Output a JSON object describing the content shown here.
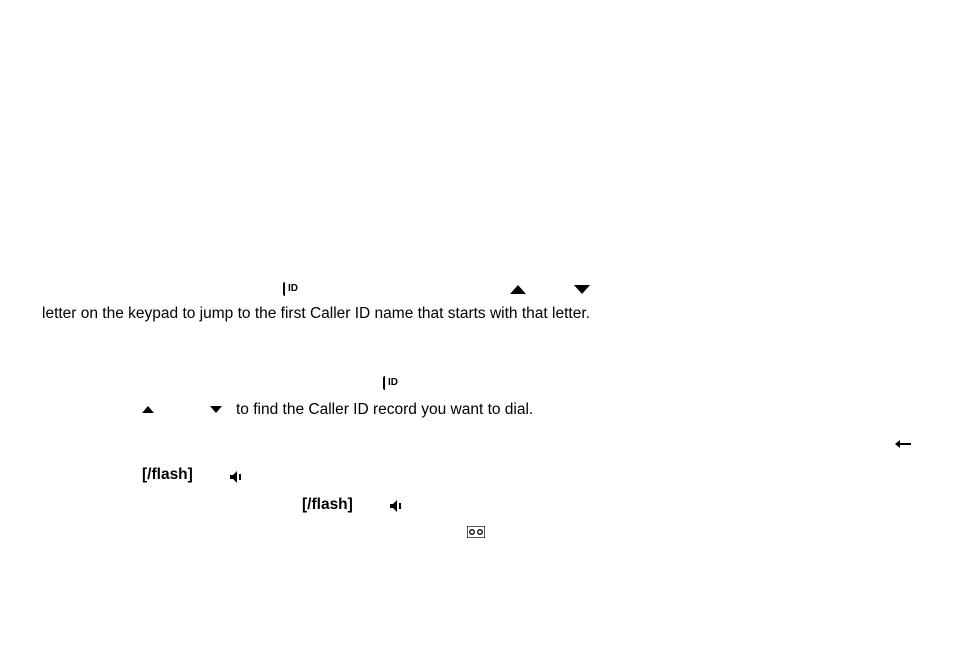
{
  "block1": {
    "line1_before_cid": " ",
    "line1_after_cid": " ",
    "line2": "letter on the keypad to jump to the first Caller ID name that starts with that letter."
  },
  "block2": {
    "line1_before_cid": " ",
    "line1_after_cid": " ",
    "line2_after_arrows": " to find the Caller ID record you want to dial."
  },
  "block3": {
    "flash_label": "/flash]",
    "line2_flash": "/flash]"
  }
}
